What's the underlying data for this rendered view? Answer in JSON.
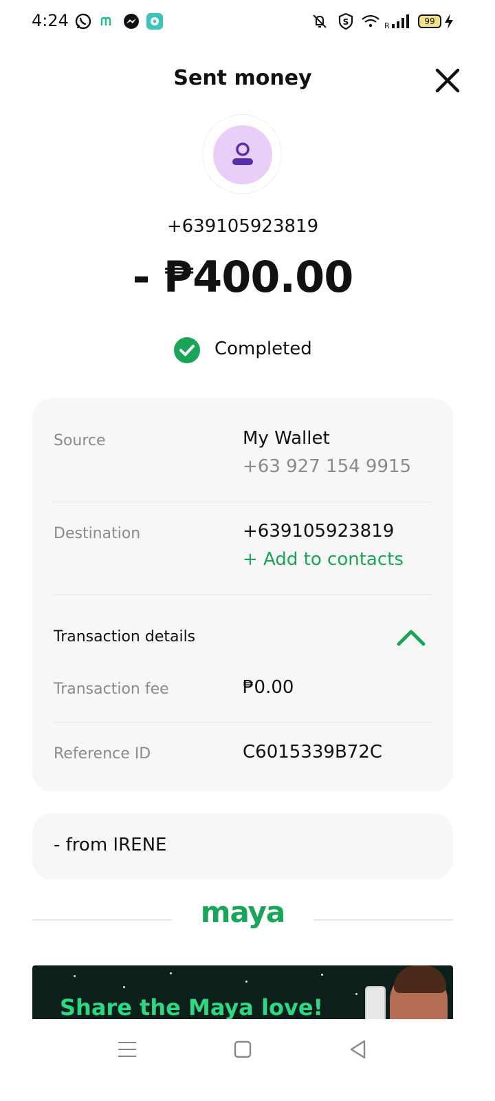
{
  "status_bar": {
    "time": "4:24",
    "battery": "99",
    "icons": [
      "whatsapp-icon",
      "maya-notification-icon",
      "messenger-icon",
      "chat-app-icon",
      "mute-icon",
      "shield-icon",
      "wifi-icon",
      "signal-icon",
      "battery-icon",
      "charging-icon"
    ]
  },
  "header": {
    "title": "Sent money",
    "close_icon": "close-icon"
  },
  "transaction": {
    "recipient": "+639105923819",
    "amount": "- ₱400.00",
    "status": "Completed"
  },
  "details": {
    "source_label": "Source",
    "source_name": "My Wallet",
    "source_number": "+63 927 154 9915",
    "destination_label": "Destination",
    "destination_number": "+639105923819",
    "add_contacts": "+ Add to contacts",
    "section_title": "Transaction details",
    "fee_label": "Transaction fee",
    "fee_value": "₱0.00",
    "ref_label": "Reference ID",
    "ref_value": "C6015339B72C"
  },
  "message": {
    "text": "- from IRENE"
  },
  "brand": {
    "logo": "maya"
  },
  "banner": {
    "text": "Share the Maya love!"
  },
  "colors": {
    "accent": "#19a557",
    "avatar_bg": "#e9cef8",
    "avatar_icon": "#5b2ea8",
    "card_bg": "#f7f7f7"
  }
}
